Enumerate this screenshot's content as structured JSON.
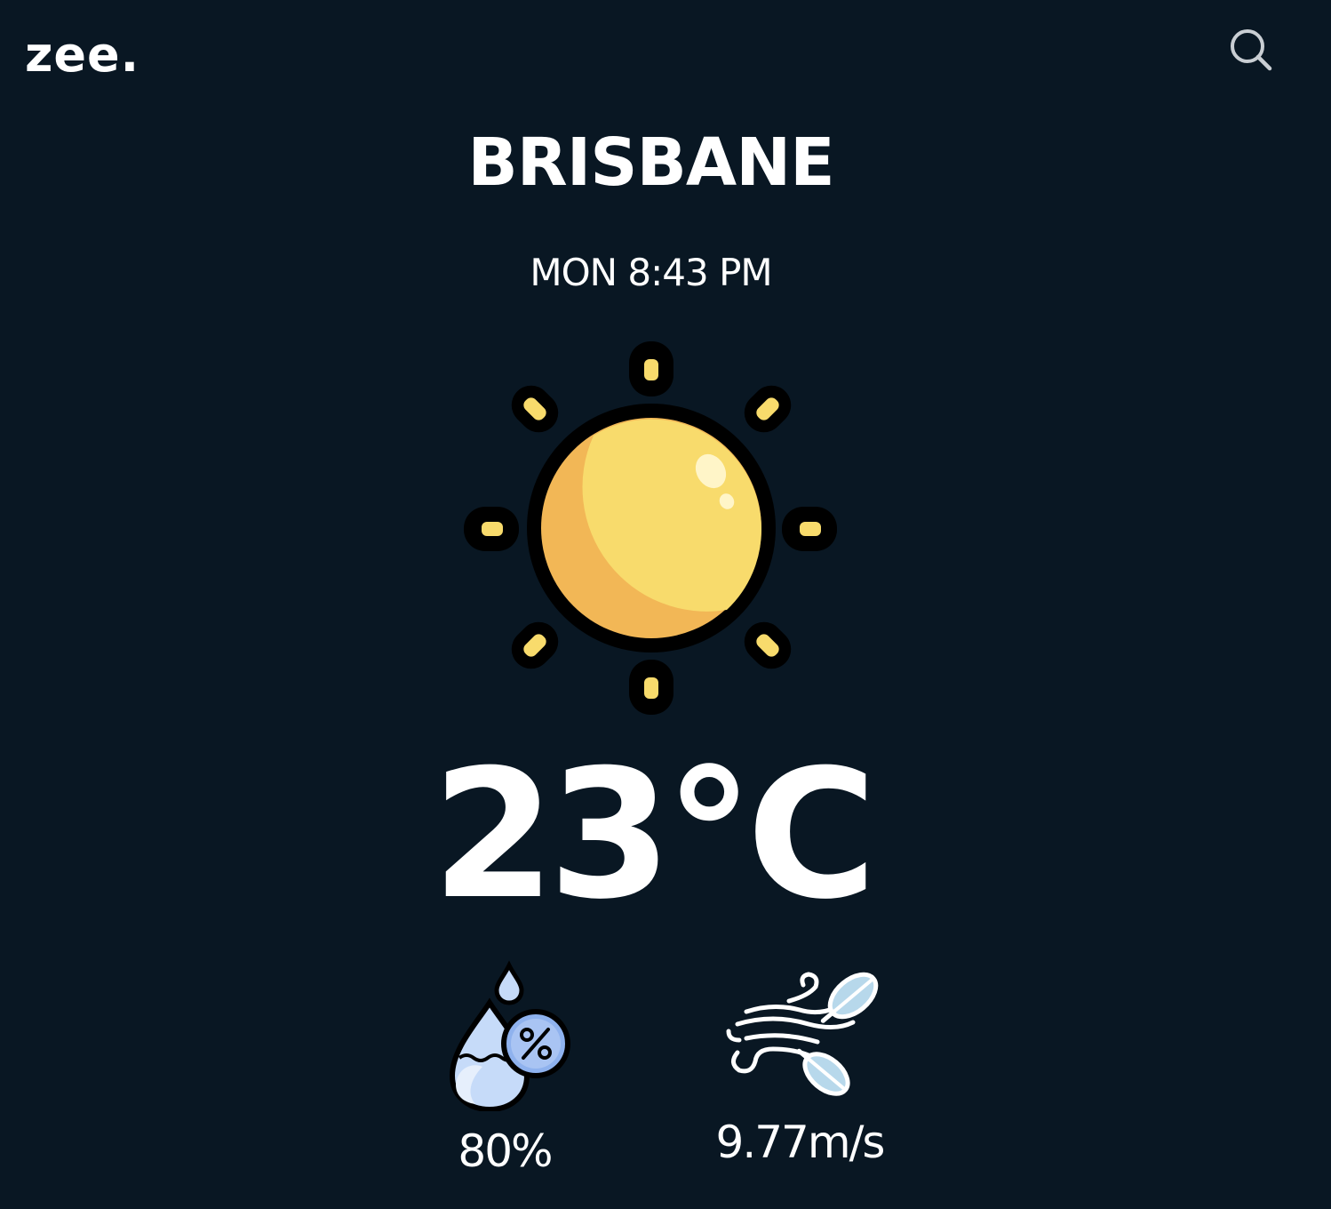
{
  "header": {
    "logo": "zee.",
    "search_icon": "search-icon"
  },
  "location": {
    "city": "BRISBANE",
    "datetime": "MON 8:43 PM"
  },
  "weather": {
    "icon": "sun-icon",
    "temperature": "23°C"
  },
  "stats": {
    "humidity": {
      "icon": "humidity-icon",
      "value": "80%"
    },
    "wind": {
      "icon": "wind-icon",
      "value": "9.77m/s"
    }
  },
  "colors": {
    "background": "#091723",
    "text": "#ffffff",
    "sun_light": "#F8DB6C",
    "sun_dark": "#F2B756",
    "drop_light": "#C6DBF9",
    "drop_dark": "#8FB2EE",
    "leaf": "#B7D8EB"
  }
}
